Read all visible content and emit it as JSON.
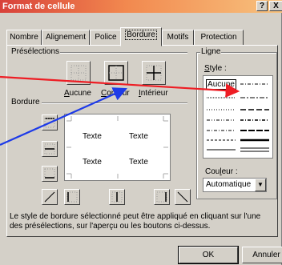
{
  "window": {
    "title": "Format de cellule",
    "help_label": "?",
    "close_label": "X"
  },
  "tabs": [
    {
      "label": "Nombre",
      "active": false
    },
    {
      "label": "Alignement",
      "active": false
    },
    {
      "label": "Police",
      "active": false
    },
    {
      "label": "Bordure",
      "active": true
    },
    {
      "label": "Motifs",
      "active": false
    },
    {
      "label": "Protection",
      "active": false
    }
  ],
  "presets": {
    "group_label": "Présélections",
    "aucune": {
      "mnemonic": "A",
      "rest": "ucune"
    },
    "contour": {
      "mnemonic": "C",
      "rest": "ontour"
    },
    "interieur": {
      "mnemonic": "I",
      "rest": "ntérieur"
    }
  },
  "border": {
    "group_label": "Bordure",
    "preview_cells": [
      "Texte",
      "Texte",
      "Texte",
      "Texte"
    ]
  },
  "line": {
    "group_label": "Ligne",
    "style_mnemonic": "S",
    "style_rest": "tyle :",
    "selected_style": "Aucune",
    "color_label_pre": "Cou",
    "color_mnemonic": "l",
    "color_label_post": "eur :",
    "color_value": "Automatique"
  },
  "info_text": "Le style de bordure sélectionné peut être appliqué en cliquant sur l'une des présélections, sur l'aperçu ou les boutons ci-dessus.",
  "buttons": {
    "ok": "OK",
    "cancel": "Annuler"
  },
  "annotations": {
    "arrow_red": "#ee1d24",
    "arrow_blue": "#1e3be8"
  }
}
